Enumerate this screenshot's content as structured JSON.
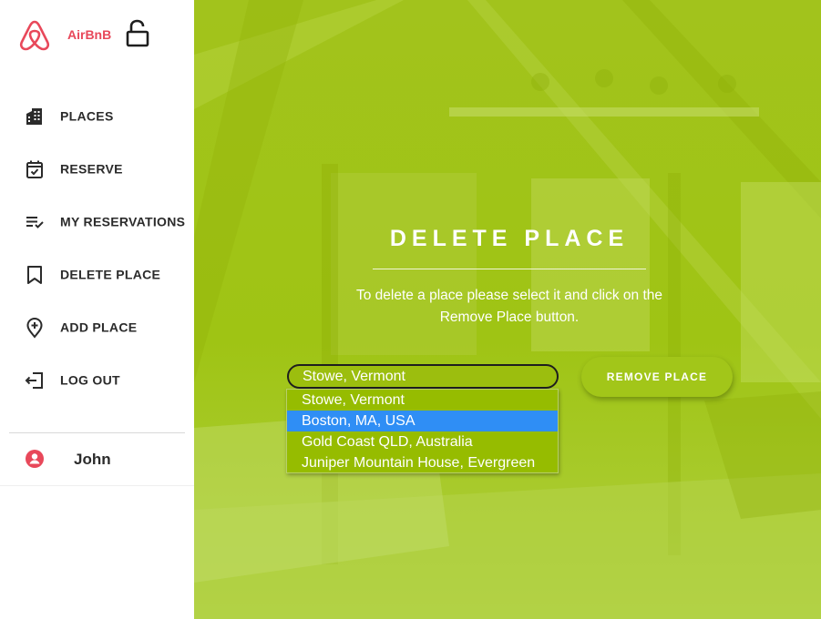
{
  "brand": {
    "name": "AirBnB"
  },
  "colors": {
    "brand": "#e8485a",
    "panel": "#a6c820",
    "selected_option": "#2f8ef5"
  },
  "nav": [
    {
      "label": "PLACES",
      "icon": "building-icon"
    },
    {
      "label": "RESERVE",
      "icon": "calendar-check-icon"
    },
    {
      "label": "MY RESERVATIONS",
      "icon": "list-check-icon"
    },
    {
      "label": "DELETE PLACE",
      "icon": "bookmark-icon"
    },
    {
      "label": "ADD PLACE",
      "icon": "location-plus-icon"
    },
    {
      "label": "LOG OUT",
      "icon": "logout-icon"
    }
  ],
  "user": {
    "name": "John"
  },
  "main": {
    "title": "DELETE PLACE",
    "description": "To delete a place please select it and click on the Remove Place button.",
    "select_value": "Stowe, Vermont",
    "options": [
      "Stowe, Vermont",
      "Boston, MA, USA",
      "Gold Coast QLD, Australia",
      "Juniper Mountain House, Evergreen"
    ],
    "highlighted_option": "Boston, MA, USA",
    "remove_button": "REMOVE PLACE"
  }
}
